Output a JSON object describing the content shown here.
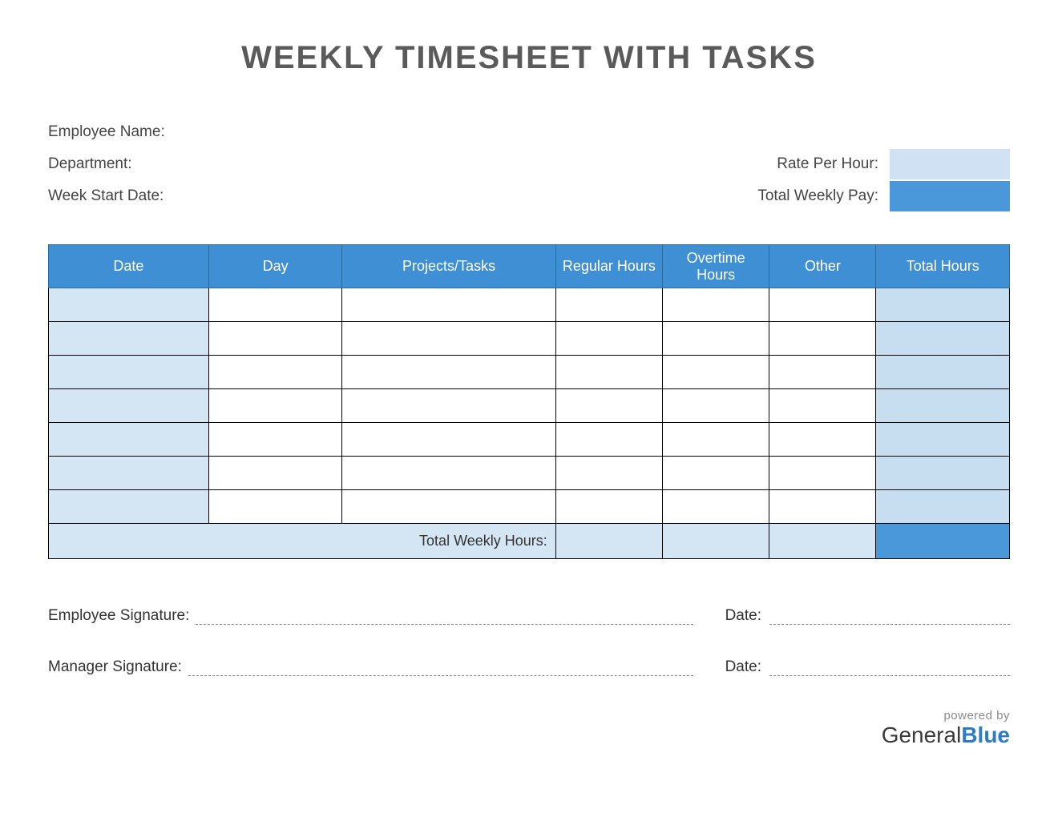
{
  "title": "WEEKLY TIMESHEET WITH TASKS",
  "labels": {
    "employee_name": "Employee Name:",
    "department": "Department:",
    "week_start": "Week Start Date:",
    "rate_per_hour": "Rate Per Hour:",
    "total_weekly_pay": "Total Weekly Pay:",
    "employee_signature": "Employee Signature:",
    "manager_signature": "Manager Signature:",
    "date": "Date:",
    "total_weekly_hours": "Total Weekly Hours:"
  },
  "columns": {
    "date": "Date",
    "day": "Day",
    "projects": "Projects/Tasks",
    "regular": "Regular Hours",
    "overtime": "Overtime Hours",
    "other": "Other",
    "total": "Total Hours"
  },
  "branding": {
    "powered_by": "powered by",
    "name_left": "General",
    "name_right": "Blue"
  },
  "values": {
    "employee_name": "",
    "department": "",
    "week_start": "",
    "rate_per_hour": "",
    "total_weekly_pay": ""
  },
  "rows": [
    {
      "date": "",
      "day": "",
      "projects": "",
      "regular": "",
      "overtime": "",
      "other": "",
      "total": ""
    },
    {
      "date": "",
      "day": "",
      "projects": "",
      "regular": "",
      "overtime": "",
      "other": "",
      "total": ""
    },
    {
      "date": "",
      "day": "",
      "projects": "",
      "regular": "",
      "overtime": "",
      "other": "",
      "total": ""
    },
    {
      "date": "",
      "day": "",
      "projects": "",
      "regular": "",
      "overtime": "",
      "other": "",
      "total": ""
    },
    {
      "date": "",
      "day": "",
      "projects": "",
      "regular": "",
      "overtime": "",
      "other": "",
      "total": ""
    },
    {
      "date": "",
      "day": "",
      "projects": "",
      "regular": "",
      "overtime": "",
      "other": "",
      "total": ""
    },
    {
      "date": "",
      "day": "",
      "projects": "",
      "regular": "",
      "overtime": "",
      "other": "",
      "total": ""
    }
  ],
  "totals": {
    "regular": "",
    "overtime": "",
    "other": "",
    "total": ""
  }
}
